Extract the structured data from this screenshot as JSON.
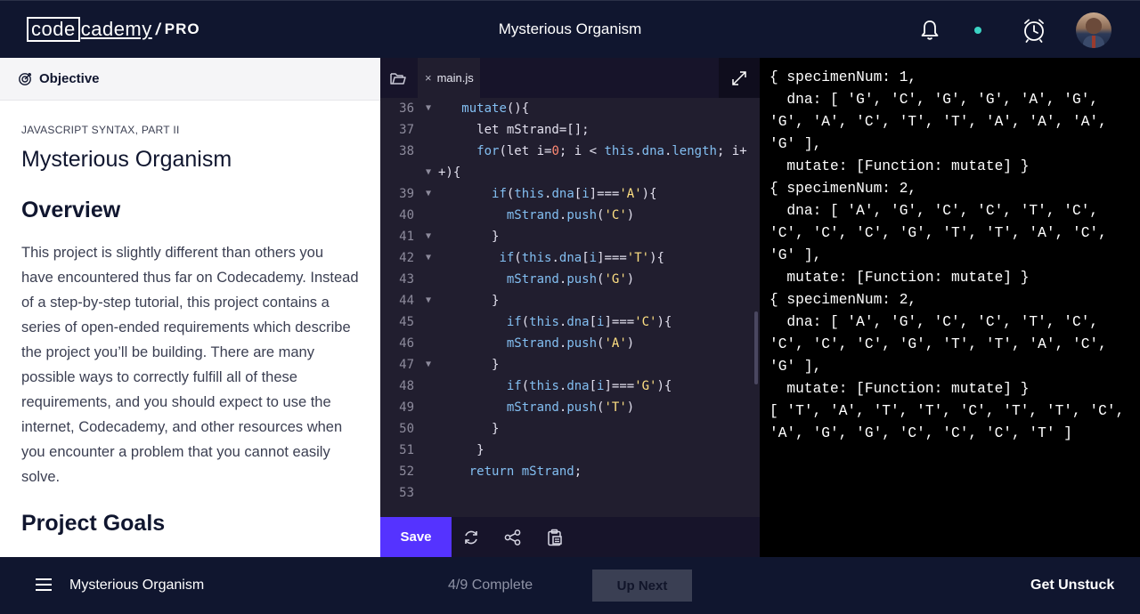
{
  "header": {
    "logo_code": "code",
    "logo_rest": "cademy",
    "logo_slash": "/",
    "logo_pro": "PRO",
    "title": "Mysterious Organism",
    "status_color": "#3bd3c4"
  },
  "objective": {
    "label": "Objective"
  },
  "lesson": {
    "kicker": "JAVASCRIPT SYNTAX, PART II",
    "title": "Mysterious Organism",
    "overview_heading": "Overview",
    "paragraph": "This project is slightly different than others you have encountered thus far on Codecademy. Instead of a step-by-step tutorial, this project contains a series of open-ended requirements which describe the project you’ll be building. There are many possible ways to correctly fulfill all of these requirements, and you should expect to use the internet, Codecademy, and other resources when you encounter a problem that you cannot easily solve.",
    "goals_heading": "Project Goals"
  },
  "editor": {
    "tab_close": "×",
    "tab_label": "main.js",
    "save_label": "Save",
    "lines": [
      {
        "n": "36",
        "fold": true
      },
      {
        "n": "37",
        "fold": false
      },
      {
        "n": "38",
        "fold": false
      },
      {
        "n": "",
        "fold": true
      },
      {
        "n": "39",
        "fold": true
      },
      {
        "n": "40",
        "fold": false
      },
      {
        "n": "41",
        "fold": true
      },
      {
        "n": "42",
        "fold": true
      },
      {
        "n": "43",
        "fold": false
      },
      {
        "n": "44",
        "fold": true
      },
      {
        "n": "45",
        "fold": false
      },
      {
        "n": "46",
        "fold": false
      },
      {
        "n": "47",
        "fold": true
      },
      {
        "n": "48",
        "fold": false
      },
      {
        "n": "49",
        "fold": false
      },
      {
        "n": "50",
        "fold": false
      },
      {
        "n": "51",
        "fold": false
      },
      {
        "n": "52",
        "fold": false
      },
      {
        "n": "53",
        "fold": false
      }
    ]
  },
  "output": {
    "text": "{ specimenNum: 1,\n  dna: [ 'G', 'C', 'G', 'G', 'A', 'G',\n'G', 'A', 'C', 'T', 'T', 'A', 'A', 'A',\n'G' ],\n  mutate: [Function: mutate] }\n{ specimenNum: 2,\n  dna: [ 'A', 'G', 'C', 'C', 'T', 'C',\n'C', 'C', 'C', 'G', 'T', 'T', 'A', 'C',\n'G' ],\n  mutate: [Function: mutate] }\n{ specimenNum: 2,\n  dna: [ 'A', 'G', 'C', 'C', 'T', 'C',\n'C', 'C', 'C', 'G', 'T', 'T', 'A', 'C',\n'G' ],\n  mutate: [Function: mutate] }\n[ 'T', 'A', 'T', 'T', 'C', 'T', 'T', 'C',\n'A', 'G', 'G', 'C', 'C', 'C', 'T' ]"
  },
  "footer": {
    "title": "Mysterious Organism",
    "progress": "4/9 Complete",
    "up_next": "Up Next",
    "get_unstuck": "Get Unstuck"
  }
}
